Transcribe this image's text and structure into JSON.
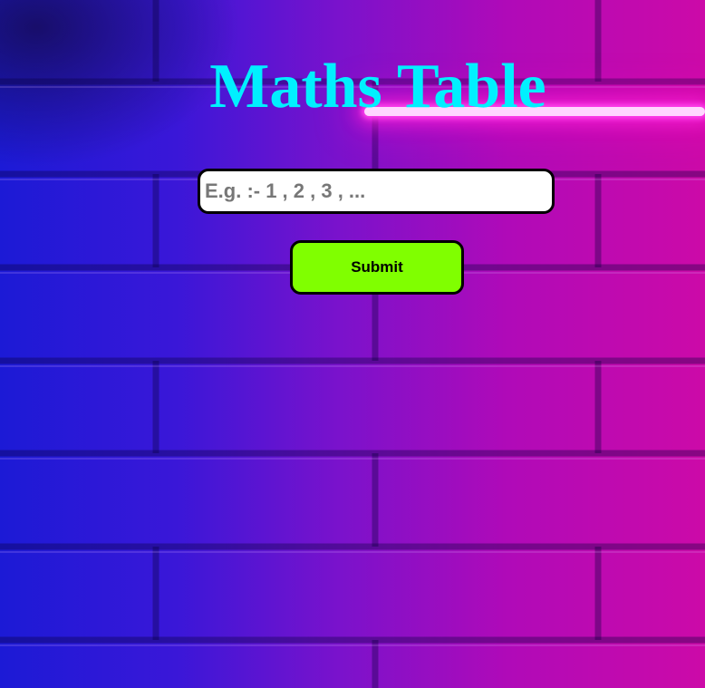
{
  "page": {
    "title": "Maths Table"
  },
  "form": {
    "number_input": {
      "value": "",
      "placeholder": "E.g. :- 1 , 2 , 3 , ..."
    },
    "submit_label": "Submit"
  },
  "colors": {
    "title": "#00f0ff",
    "submit_background": "#80ff00",
    "background_left": "#1c1ad6",
    "background_right": "#cc0aa8",
    "neon": "#ff44ee"
  }
}
